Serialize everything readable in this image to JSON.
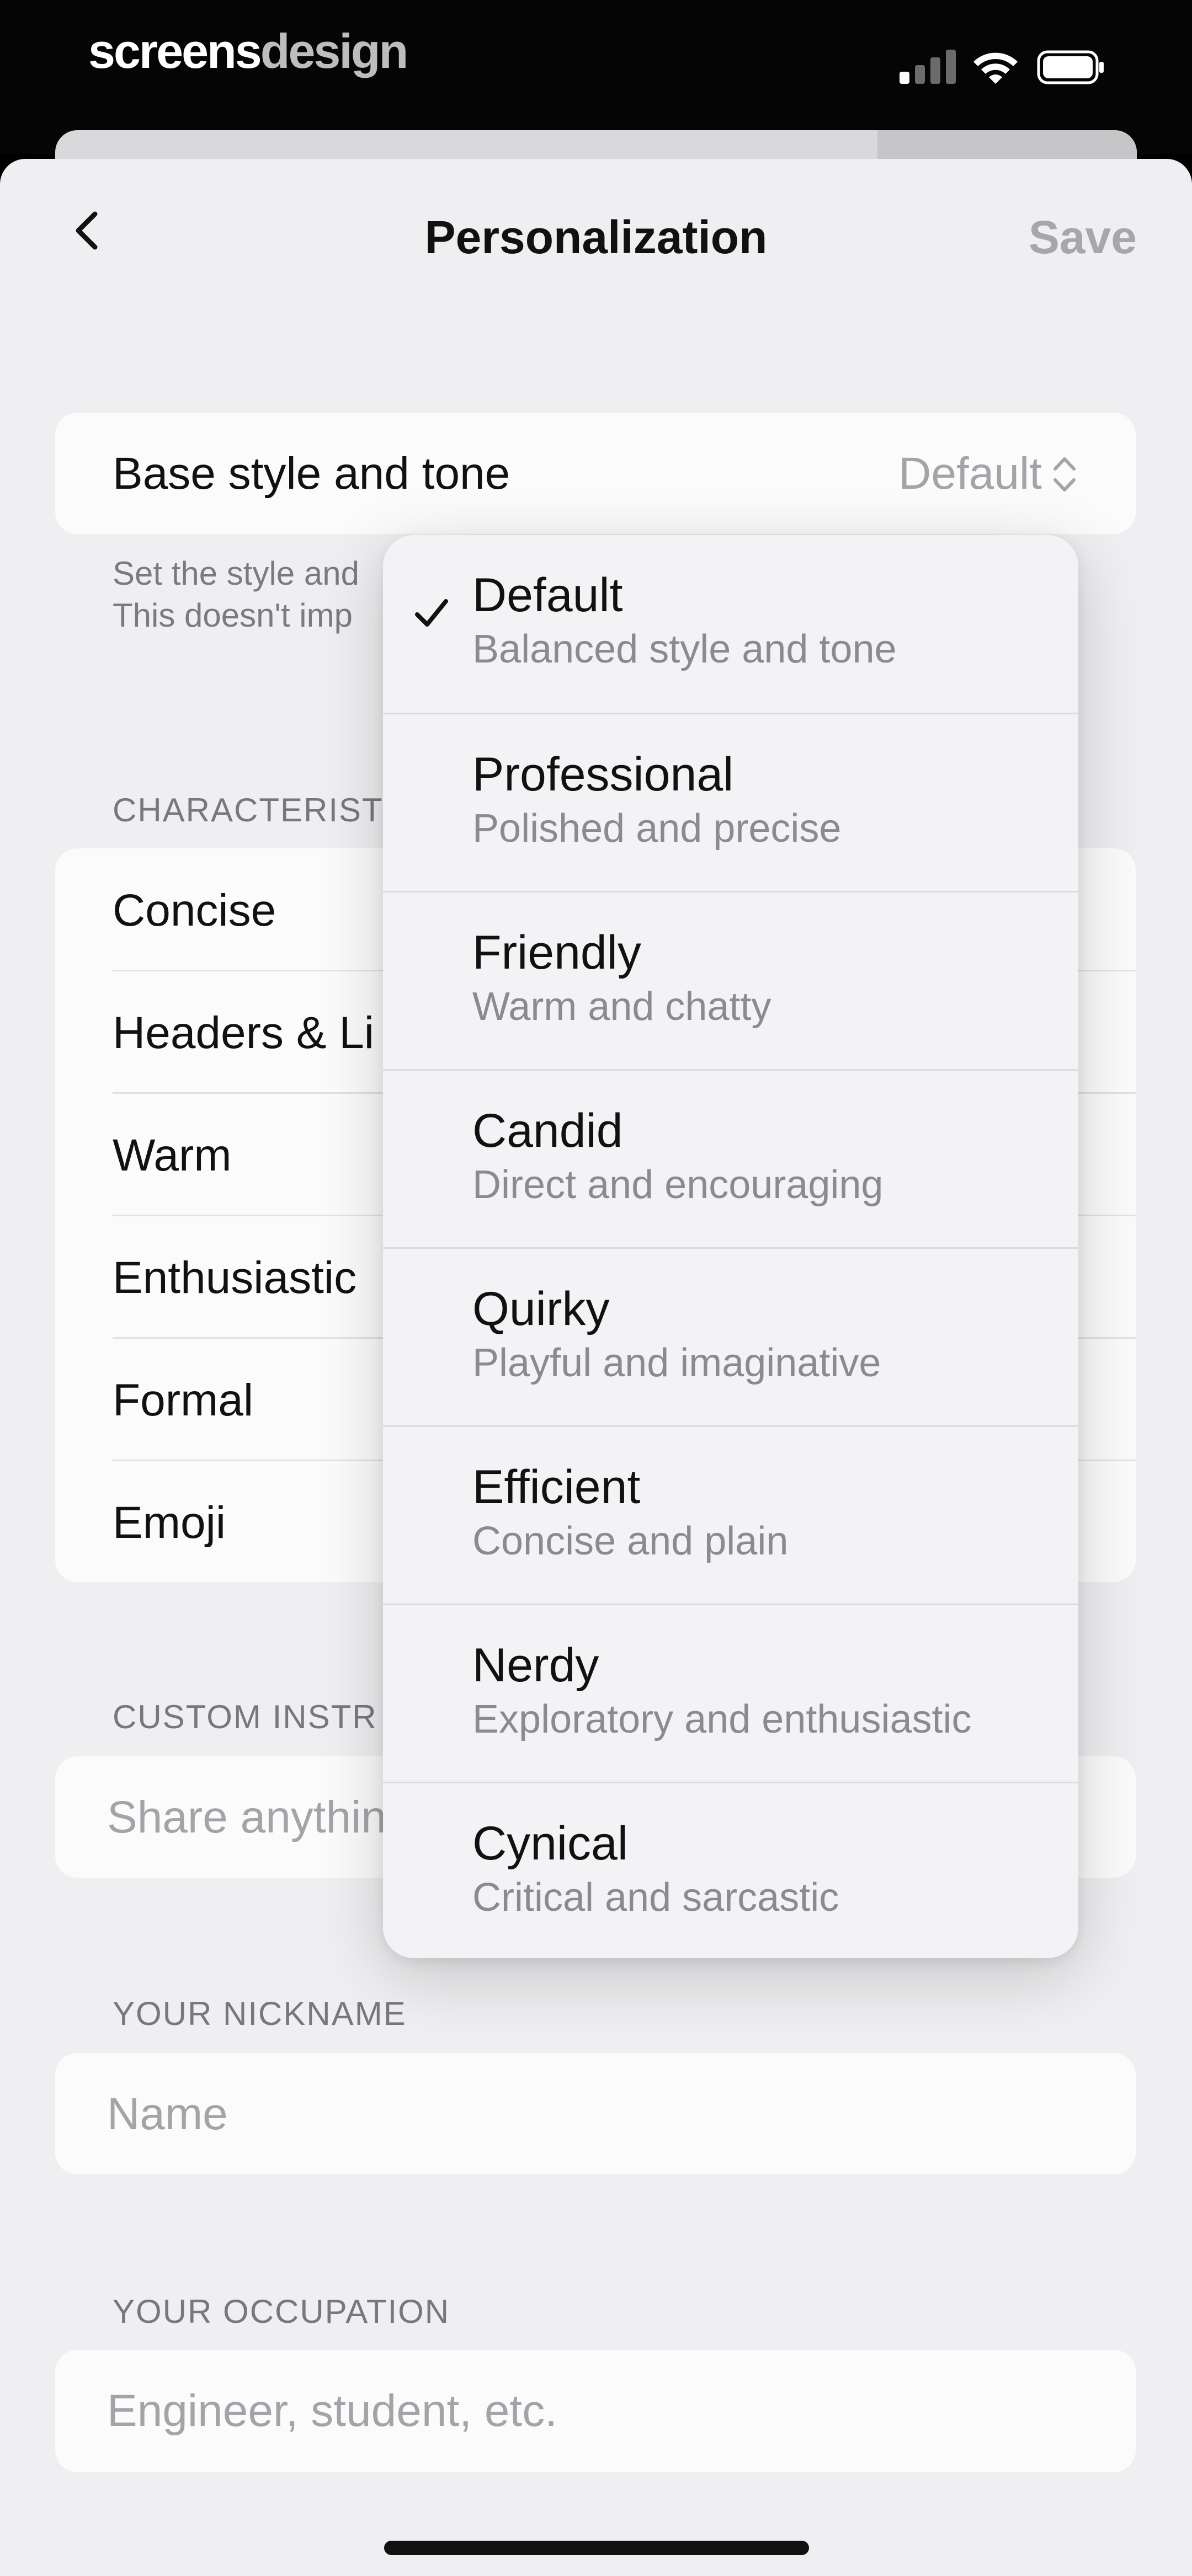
{
  "status_bar": {
    "brand_part1": "screens",
    "brand_part2": "design"
  },
  "nav": {
    "title": "Personalization",
    "save_label": "Save"
  },
  "base_style": {
    "label": "Base style and tone",
    "value": "Default",
    "help_line1": "Set the style and",
    "help_line2": "This doesn't imp"
  },
  "characteristics": {
    "header": "CHARACTERIST",
    "items": [
      "Concise",
      "Headers & Li",
      "Warm",
      "Enthusiastic",
      "Formal",
      "Emoji"
    ]
  },
  "custom_instructions": {
    "header": "CUSTOM INSTR",
    "placeholder": "Share anythin"
  },
  "nickname": {
    "header": "YOUR NICKNAME",
    "placeholder": "Name"
  },
  "occupation": {
    "header": "YOUR OCCUPATION",
    "placeholder": "Engineer, student, etc."
  },
  "menu": {
    "selected": "Default",
    "options": [
      {
        "title": "Default",
        "subtitle": "Balanced style and tone"
      },
      {
        "title": "Professional",
        "subtitle": "Polished and precise"
      },
      {
        "title": "Friendly",
        "subtitle": "Warm and chatty"
      },
      {
        "title": "Candid",
        "subtitle": "Direct and encouraging"
      },
      {
        "title": "Quirky",
        "subtitle": "Playful and imaginative"
      },
      {
        "title": "Efficient",
        "subtitle": "Concise and plain"
      },
      {
        "title": "Nerdy",
        "subtitle": "Exploratory and enthusiastic"
      },
      {
        "title": "Cynical",
        "subtitle": "Critical and sarcastic"
      }
    ]
  },
  "icons": {
    "back": "chevron-left-icon",
    "updown": "chevron-up-down-icon",
    "check": "checkmark-icon",
    "signal": "cellular-signal-icon",
    "wifi": "wifi-icon",
    "battery": "battery-icon"
  }
}
